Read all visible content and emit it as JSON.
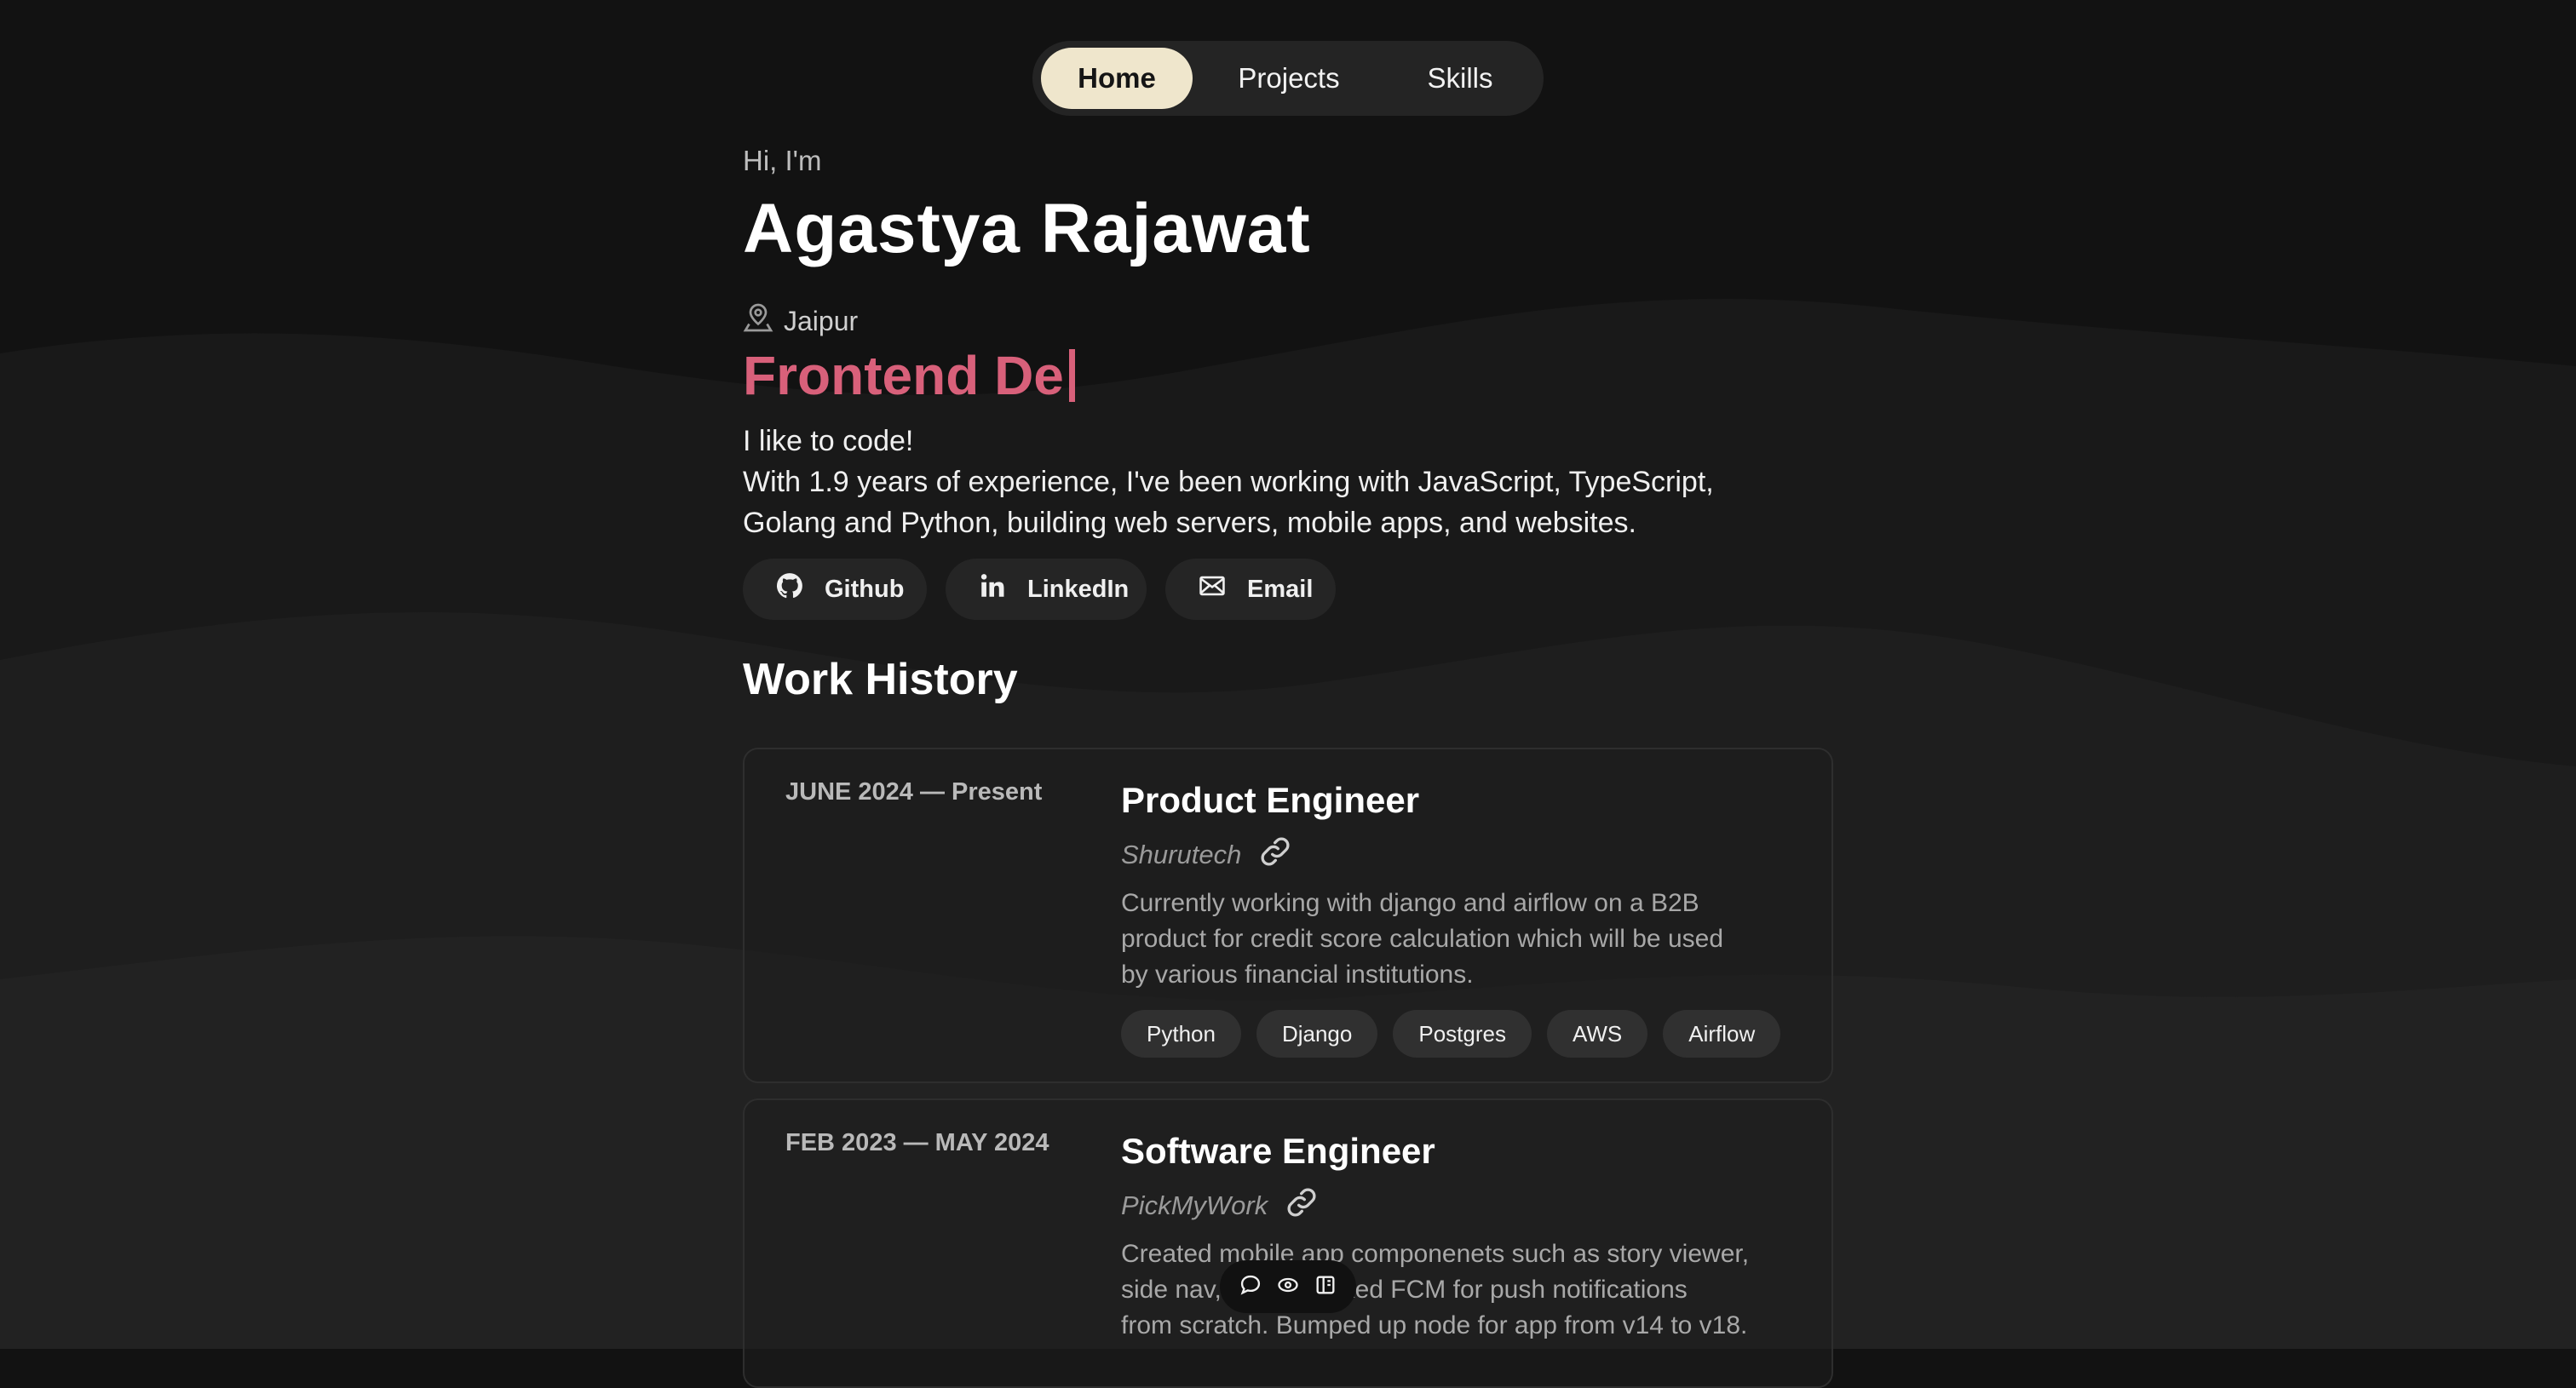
{
  "nav": {
    "items": [
      {
        "label": "Home",
        "active": true
      },
      {
        "label": "Projects"
      },
      {
        "label": "Skills"
      }
    ]
  },
  "hero": {
    "greeting": "Hi, I'm",
    "name": "Agastya Rajawat",
    "location": "Jaipur",
    "location_icon": "map-pin-icon",
    "role_typed": "Frontend De",
    "bio_lines": [
      "I like to code!",
      "With 1.9 years of experience, I've been working with JavaScript, TypeScript,",
      "Golang and Python, building web servers, mobile apps, and websites."
    ]
  },
  "socials": [
    {
      "label": "Github",
      "icon": "github-icon"
    },
    {
      "label": "LinkedIn",
      "icon": "linkedin-icon"
    },
    {
      "label": "Email",
      "icon": "mail-icon"
    }
  ],
  "work": {
    "title": "Work History",
    "jobs": [
      {
        "date": "JUNE 2024 — Present",
        "title": "Product Engineer",
        "company": "Shurutech",
        "desc_lines": [
          "Currently working with django and airflow on a B2B",
          "product for credit score calculation which will be used",
          "by various financial institutions."
        ],
        "tags": [
          "Python",
          "Django",
          "Postgres",
          "AWS",
          "Airflow"
        ]
      },
      {
        "date": "FEB 2023 — MAY 2024",
        "title": "Software Engineer",
        "company": "PickMyWork",
        "desc_lines": [
          "Created mobile app componenets such as story viewer,",
          "side nav, and reworked FCM for push notifications",
          "from scratch. Bumped up node for app from v14 to v18."
        ]
      }
    ]
  },
  "toolbar": {
    "icons": [
      "comment-icon",
      "eye-icon",
      "panel-icon"
    ]
  },
  "colors": {
    "background": "#121212",
    "accent": "#d8607a",
    "nav_active": "#efe6cc"
  }
}
